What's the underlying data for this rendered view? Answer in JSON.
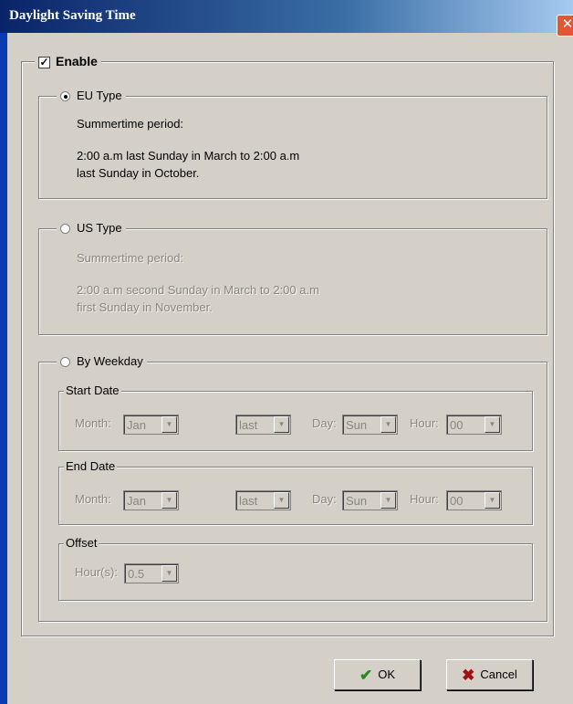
{
  "window": {
    "title": "Daylight Saving Time",
    "close_glyph": "✕"
  },
  "enable": {
    "label": "Enable",
    "checked": true,
    "check_glyph": "✓"
  },
  "eu": {
    "label": "EU Type",
    "selected": true,
    "period_label": "Summertime period:",
    "line1": "2:00 a.m last Sunday in March to  2:00 a.m",
    "line2": "last Sunday in October."
  },
  "us": {
    "label": "US Type",
    "selected": false,
    "period_label": "Summertime period:",
    "line1": "2:00 a.m second Sunday in March to  2:00 a.m",
    "line2": "first Sunday in November."
  },
  "weekday": {
    "label": "By Weekday",
    "selected": false,
    "start": {
      "legend": "Start Date",
      "month_label": "Month:",
      "month_value": "Jan",
      "week_value": "last",
      "day_label": "Day:",
      "day_value": "Sun",
      "hour_label": "Hour:",
      "hour_value": "00"
    },
    "end": {
      "legend": "End Date",
      "month_label": "Month:",
      "month_value": "Jan",
      "week_value": "last",
      "day_label": "Day:",
      "day_value": "Sun",
      "hour_label": "Hour:",
      "hour_value": "00"
    },
    "offset": {
      "legend": "Offset",
      "hours_label": "Hour(s):",
      "hours_value": "0.5"
    }
  },
  "buttons": {
    "ok_label": "OK",
    "ok_icon": "checkmark-icon",
    "cancel_label": "Cancel",
    "cancel_icon": "x-icon"
  },
  "colors": {
    "dialog_bg": "#d4d0c8",
    "titlebar_start": "#0a246a",
    "close_button": "#e25535",
    "ok_icon": "#2e8b1e",
    "cancel_icon": "#a01010"
  }
}
